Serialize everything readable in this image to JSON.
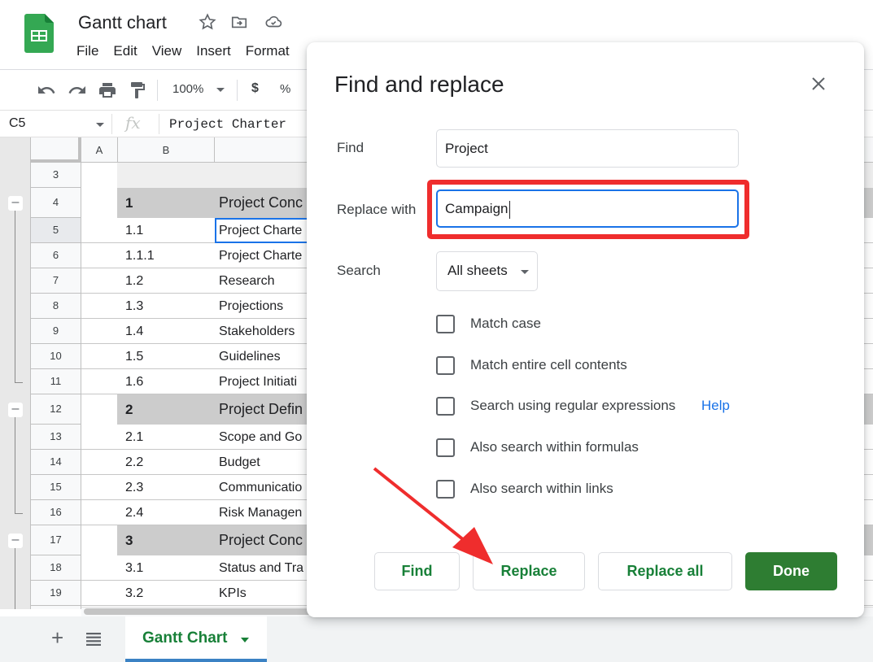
{
  "header": {
    "title": "Gantt chart",
    "menu": [
      "File",
      "Edit",
      "View",
      "Insert",
      "Format"
    ]
  },
  "toolbar": {
    "zoom": "100%",
    "currency": "$",
    "percent": "%"
  },
  "formula_bar": {
    "cell_ref": "C5",
    "fx": "fx",
    "value": "Project Charter"
  },
  "columns": [
    "A",
    "B"
  ],
  "rows": [
    {
      "num": "3",
      "type": "spacer",
      "b": "",
      "c": ""
    },
    {
      "num": "4",
      "type": "group",
      "b": "1",
      "c": "Project Conc"
    },
    {
      "num": "5",
      "type": "data",
      "b": "1.1",
      "c": "Project Charte"
    },
    {
      "num": "6",
      "type": "data",
      "b": "1.1.1",
      "c": "Project Charte"
    },
    {
      "num": "7",
      "type": "data",
      "b": "1.2",
      "c": "Research"
    },
    {
      "num": "8",
      "type": "data",
      "b": "1.3",
      "c": "Projections"
    },
    {
      "num": "9",
      "type": "data",
      "b": "1.4",
      "c": "Stakeholders"
    },
    {
      "num": "10",
      "type": "data",
      "b": "1.5",
      "c": "Guidelines"
    },
    {
      "num": "11",
      "type": "data",
      "b": "1.6",
      "c": "Project Initiati"
    },
    {
      "num": "12",
      "type": "group",
      "b": "2",
      "c": "Project Defin"
    },
    {
      "num": "13",
      "type": "data",
      "b": "2.1",
      "c": "Scope and Go"
    },
    {
      "num": "14",
      "type": "data",
      "b": "2.2",
      "c": "Budget"
    },
    {
      "num": "15",
      "type": "data",
      "b": "2.3",
      "c": "Communicatio"
    },
    {
      "num": "16",
      "type": "data",
      "b": "2.4",
      "c": "Risk Managen"
    },
    {
      "num": "17",
      "type": "group",
      "b": "3",
      "c": "Project Conc"
    },
    {
      "num": "18",
      "type": "data",
      "b": "3.1",
      "c": "Status and Tra"
    },
    {
      "num": "19",
      "type": "data",
      "b": "3.2",
      "c": "KPIs"
    }
  ],
  "bottom_bar": {
    "add_sheet": "+",
    "active_sheet": "Gantt Chart"
  },
  "dialog": {
    "title": "Find and replace",
    "find_label": "Find",
    "find_value": "Project",
    "replace_label": "Replace with",
    "replace_value": "Campaign",
    "search_label": "Search",
    "search_scope": "All sheets",
    "options": [
      {
        "label": "Match case",
        "checked": false
      },
      {
        "label": "Match entire cell contents",
        "checked": false
      },
      {
        "label": "Search using regular expressions",
        "checked": false
      },
      {
        "label": "Also search within formulas",
        "checked": false
      },
      {
        "label": "Also search within links",
        "checked": false
      }
    ],
    "help_link": "Help",
    "buttons": {
      "find": "Find",
      "replace": "Replace",
      "replace_all": "Replace all",
      "done": "Done"
    }
  },
  "colors": {
    "brand_green": "#188038",
    "done_button": "#2e7d32",
    "focus_blue": "#1a73e8",
    "annotation_red": "#ef2d2d"
  }
}
